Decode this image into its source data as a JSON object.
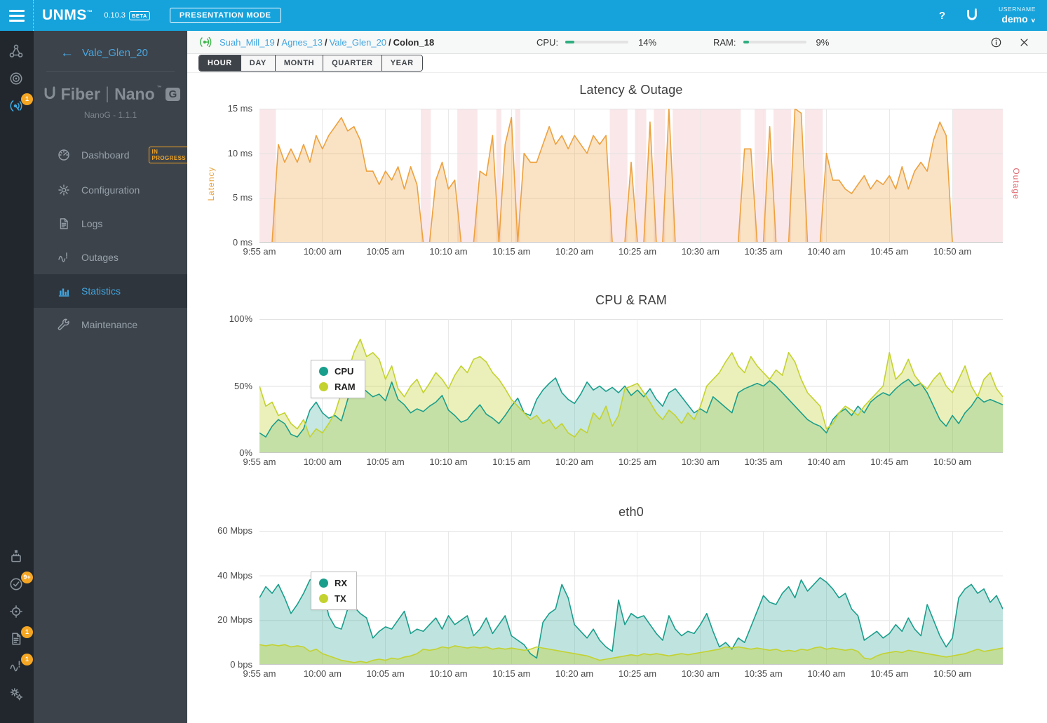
{
  "topbar": {
    "app_name": "UNMS",
    "trademark": "™",
    "version": "0.10.3",
    "beta_label": "BETA",
    "presentation_mode_label": "PRESENTATION MODE",
    "help_label": "?",
    "username_label": "USERNAME",
    "username_value": "demo",
    "bar_color": "#16a3dc"
  },
  "rail": {
    "top_items": [
      {
        "icon": "sites-icon",
        "badge": "",
        "active": false
      },
      {
        "icon": "endpoints-icon",
        "badge": "",
        "active": false
      },
      {
        "icon": "devices-icon",
        "badge": "1",
        "active": true
      }
    ],
    "bottom_items": [
      {
        "icon": "firmware-icon",
        "badge": "",
        "active": false
      },
      {
        "icon": "tasks-icon",
        "badge": "9+",
        "active": false
      },
      {
        "icon": "discovery-icon",
        "badge": "",
        "active": false
      },
      {
        "icon": "logs-icon",
        "badge": "1",
        "active": false
      },
      {
        "icon": "outages-icon",
        "badge": "1",
        "active": false
      },
      {
        "icon": "settings-icon",
        "badge": "",
        "active": false
      }
    ],
    "badge_color": "#f5a623"
  },
  "sidebar": {
    "back_label": "Vale_Glen_20",
    "device_logo": {
      "brand_word": "Fiber",
      "series_word": "Nano",
      "trademark": "™",
      "model_letter": "G"
    },
    "device_subtitle": "NanoG - 1.1.1",
    "menu": [
      {
        "label": "Dashboard",
        "icon": "dashboard-icon",
        "badge": "IN PROGRESS",
        "active": false
      },
      {
        "label": "Configuration",
        "icon": "configuration-icon",
        "badge": "",
        "active": false
      },
      {
        "label": "Logs",
        "icon": "logs-doc-icon",
        "badge": "",
        "active": false
      },
      {
        "label": "Outages",
        "icon": "outage-pulse-icon",
        "badge": "",
        "active": false
      },
      {
        "label": "Statistics",
        "icon": "statistics-icon",
        "badge": "",
        "active": true
      },
      {
        "label": "Maintenance",
        "icon": "maintenance-icon",
        "badge": "",
        "active": false
      }
    ]
  },
  "header": {
    "breadcrumbs": [
      {
        "label": "Suah_Mill_19",
        "current": false
      },
      {
        "label": "Agnes_13",
        "current": false
      },
      {
        "label": "Vale_Glen_20",
        "current": false
      },
      {
        "label": "Colon_18",
        "current": true
      }
    ],
    "cpu_label": "CPU:",
    "cpu_value": "14%",
    "cpu_percent": 14,
    "ram_label": "RAM:",
    "ram_value": "9%",
    "ram_percent": 9,
    "meter_color": "#2fae80"
  },
  "tabs": {
    "items": [
      {
        "label": "HOUR",
        "active": true
      },
      {
        "label": "DAY",
        "active": false
      },
      {
        "label": "MONTH",
        "active": false
      },
      {
        "label": "QUARTER",
        "active": false
      },
      {
        "label": "YEAR",
        "active": false
      }
    ]
  },
  "chart_data": [
    {
      "type": "area",
      "title": "Latency & Outage",
      "ylabel_left": "Latency",
      "ylabel_right": "Outage",
      "ylim": [
        0,
        15
      ],
      "y_ticks": [
        "0 ms",
        "5 ms",
        "10 ms",
        "15 ms"
      ],
      "x_ticks": [
        "9:55 am",
        "10:00 am",
        "10:05 am",
        "10:10 am",
        "10:15 am",
        "10:20 am",
        "10:25 am",
        "10:30 am",
        "10:35 am",
        "10:40 am",
        "10:45 am",
        "10:50 am"
      ],
      "x_tick_minutes": [
        0,
        5,
        10,
        15,
        20,
        25,
        30,
        35,
        40,
        45,
        50,
        55
      ],
      "x_span_minutes": 59,
      "grid": true,
      "outage_color": "#e05c6e",
      "outage_band_opacity": 0.15,
      "outage_bands_minutes": [
        [
          0,
          1.3
        ],
        [
          12.8,
          13.6
        ],
        [
          15.7,
          17.3
        ],
        [
          18.8,
          19.2
        ],
        [
          20.3,
          20.7
        ],
        [
          27.8,
          29.2
        ],
        [
          29.8,
          30.7
        ],
        [
          31.3,
          32.2
        ],
        [
          32.8,
          38.2
        ],
        [
          39.3,
          40.2
        ],
        [
          40.8,
          42.2
        ],
        [
          43.3,
          44.7
        ],
        [
          55,
          59
        ]
      ],
      "series": [
        {
          "name": "Latency (ms)",
          "color": "#eda13f",
          "fill_opacity": 0.3,
          "values": [
            0,
            0,
            0,
            11,
            9,
            10.5,
            9,
            11,
            9,
            12,
            10.5,
            12,
            13,
            14,
            12.5,
            13,
            11.5,
            8,
            8,
            6.5,
            8,
            7,
            8.5,
            6,
            8.5,
            6.5,
            0,
            0,
            7,
            9,
            6,
            7,
            0,
            0,
            0,
            8,
            7.5,
            12,
            0,
            11,
            14,
            0,
            10,
            9,
            9,
            11,
            13,
            11,
            12,
            10.5,
            12,
            11,
            10,
            12,
            11,
            12,
            0,
            0,
            0,
            9,
            0,
            0,
            13.5,
            0,
            0,
            15,
            0,
            0,
            0,
            0,
            0,
            0,
            0,
            0,
            0,
            0,
            0,
            10.5,
            10.5,
            0,
            0,
            13,
            0,
            0,
            0,
            15,
            14.5,
            0,
            0,
            0,
            10,
            7,
            7,
            6,
            5.5,
            6.5,
            7.5,
            6,
            7,
            6.5,
            7.5,
            6,
            8.5,
            6,
            8,
            9,
            8,
            11.5,
            13.5,
            12,
            0,
            0,
            0,
            0,
            0,
            0,
            0,
            0,
            0
          ]
        }
      ]
    },
    {
      "type": "area",
      "title": "CPU & RAM",
      "ylim": [
        0,
        100
      ],
      "y_ticks": [
        "0%",
        "50%",
        "100%"
      ],
      "x_ticks": [
        "9:55 am",
        "10:00 am",
        "10:05 am",
        "10:10 am",
        "10:15 am",
        "10:20 am",
        "10:25 am",
        "10:30 am",
        "10:35 am",
        "10:40 am",
        "10:45 am",
        "10:50 am"
      ],
      "x_tick_minutes": [
        0,
        5,
        10,
        15,
        20,
        25,
        30,
        35,
        40,
        45,
        50,
        55
      ],
      "x_span_minutes": 59,
      "grid": true,
      "legend_position": "top-left",
      "series": [
        {
          "name": "CPU",
          "color": "#1a9e8c",
          "fill_opacity": 0.25,
          "values": [
            15,
            12,
            20,
            25,
            22,
            14,
            12,
            18,
            32,
            38,
            30,
            26,
            28,
            24,
            40,
            55,
            50,
            46,
            42,
            44,
            39,
            53,
            40,
            36,
            30,
            33,
            31,
            35,
            38,
            43,
            32,
            28,
            23,
            25,
            31,
            36,
            29,
            26,
            22,
            28,
            35,
            41,
            30,
            28,
            40,
            47,
            52,
            56,
            45,
            40,
            37,
            44,
            53,
            47,
            50,
            46,
            49,
            45,
            50,
            43,
            47,
            42,
            48,
            40,
            35,
            45,
            48,
            42,
            36,
            30,
            33,
            30,
            42,
            38,
            34,
            30,
            45,
            48,
            50,
            52,
            50,
            54,
            50,
            45,
            40,
            35,
            30,
            25,
            22,
            20,
            15,
            25,
            30,
            33,
            28,
            35,
            30,
            38,
            42,
            45,
            43,
            48,
            52,
            55,
            50,
            52,
            45,
            35,
            25,
            20,
            28,
            22,
            30,
            35,
            42,
            38,
            40,
            38,
            36
          ]
        },
        {
          "name": "RAM",
          "color": "#c3d22f",
          "fill_opacity": 0.33,
          "values": [
            50,
            35,
            38,
            28,
            30,
            22,
            18,
            25,
            12,
            18,
            15,
            22,
            30,
            45,
            60,
            75,
            85,
            72,
            75,
            70,
            55,
            65,
            48,
            42,
            50,
            55,
            45,
            52,
            60,
            55,
            48,
            58,
            65,
            60,
            70,
            72,
            68,
            60,
            55,
            48,
            40,
            35,
            30,
            25,
            28,
            22,
            25,
            18,
            22,
            15,
            12,
            18,
            15,
            30,
            25,
            35,
            20,
            28,
            48,
            50,
            52,
            45,
            38,
            30,
            25,
            32,
            28,
            22,
            30,
            25,
            35,
            50,
            55,
            60,
            68,
            75,
            65,
            60,
            72,
            65,
            60,
            55,
            62,
            58,
            75,
            68,
            55,
            45,
            40,
            35,
            18,
            22,
            30,
            35,
            32,
            28,
            35,
            40,
            45,
            50,
            75,
            55,
            60,
            70,
            58,
            52,
            48,
            55,
            60,
            50,
            45,
            55,
            65,
            50,
            42,
            55,
            60,
            48,
            42
          ]
        }
      ]
    },
    {
      "type": "area",
      "title": "eth0",
      "ylim": [
        0,
        60
      ],
      "y_ticks": [
        "0 bps",
        "20 Mbps",
        "40 Mbps",
        "60 Mbps"
      ],
      "x_ticks": [
        "9:55 am",
        "10:00 am",
        "10:05 am",
        "10:10 am",
        "10:15 am",
        "10:20 am",
        "10:25 am",
        "10:30 am",
        "10:35 am",
        "10:40 am",
        "10:45 am",
        "10:50 am"
      ],
      "x_tick_minutes": [
        0,
        5,
        10,
        15,
        20,
        25,
        30,
        35,
        40,
        45,
        50,
        55
      ],
      "x_span_minutes": 59,
      "grid": true,
      "legend_position": "top-left",
      "series": [
        {
          "name": "RX",
          "color": "#1a9e8c",
          "fill_opacity": 0.28,
          "values": [
            30,
            35,
            32,
            36,
            30,
            23,
            27,
            32,
            38,
            39,
            35,
            22,
            17,
            16,
            25,
            26,
            23,
            21,
            12,
            15,
            17,
            16,
            20,
            24,
            14,
            16,
            15,
            18,
            21,
            16,
            22,
            18,
            20,
            22,
            13,
            16,
            21,
            14,
            18,
            22,
            13,
            11,
            9,
            5,
            3,
            19,
            23,
            25,
            36,
            30,
            18,
            15,
            12,
            16,
            11,
            8,
            6,
            29,
            18,
            23,
            21,
            22,
            18,
            14,
            11,
            22,
            16,
            13,
            15,
            14,
            18,
            23,
            15,
            8,
            10,
            7,
            12,
            10,
            17,
            24,
            31,
            28,
            27,
            32,
            35,
            30,
            38,
            33,
            36,
            39,
            37,
            34,
            30,
            32,
            25,
            22,
            11,
            13,
            15,
            12,
            14,
            18,
            15,
            21,
            16,
            13,
            27,
            20,
            13,
            8,
            12,
            30,
            34,
            36,
            32,
            34,
            28,
            31,
            25
          ]
        },
        {
          "name": "TX",
          "color": "#c3d22f",
          "fill_opacity": 0.38,
          "values": [
            9,
            8.5,
            9,
            8.5,
            9,
            8,
            8.5,
            8,
            6,
            7,
            5,
            4,
            3,
            2,
            1.5,
            1,
            1.5,
            1,
            2,
            2.5,
            2,
            3,
            2.5,
            3.5,
            4,
            5,
            7,
            6.5,
            7,
            8,
            7.5,
            8.5,
            8,
            7.5,
            8,
            7.5,
            8,
            7,
            7.5,
            7,
            7.5,
            7,
            6.5,
            7,
            8,
            7.5,
            7,
            6.5,
            6,
            5.5,
            5,
            4.5,
            4,
            3,
            2,
            2.5,
            3,
            3.5,
            4,
            4.5,
            4,
            5,
            4.5,
            5,
            4.5,
            4,
            4.5,
            5,
            4.5,
            5,
            5.5,
            6,
            6.5,
            7,
            8,
            7.5,
            8,
            7.5,
            7,
            7.5,
            7,
            6.5,
            7,
            6,
            6.5,
            6,
            7,
            6.5,
            7.5,
            8,
            7,
            7.5,
            7,
            6.5,
            7,
            6,
            3,
            2.5,
            4,
            5,
            5.5,
            6,
            5.5,
            6.5,
            6,
            5.5,
            5,
            4.5,
            4,
            3.5,
            4,
            4.5,
            5,
            6,
            7,
            6,
            6.5,
            7,
            7.5
          ]
        }
      ]
    }
  ]
}
